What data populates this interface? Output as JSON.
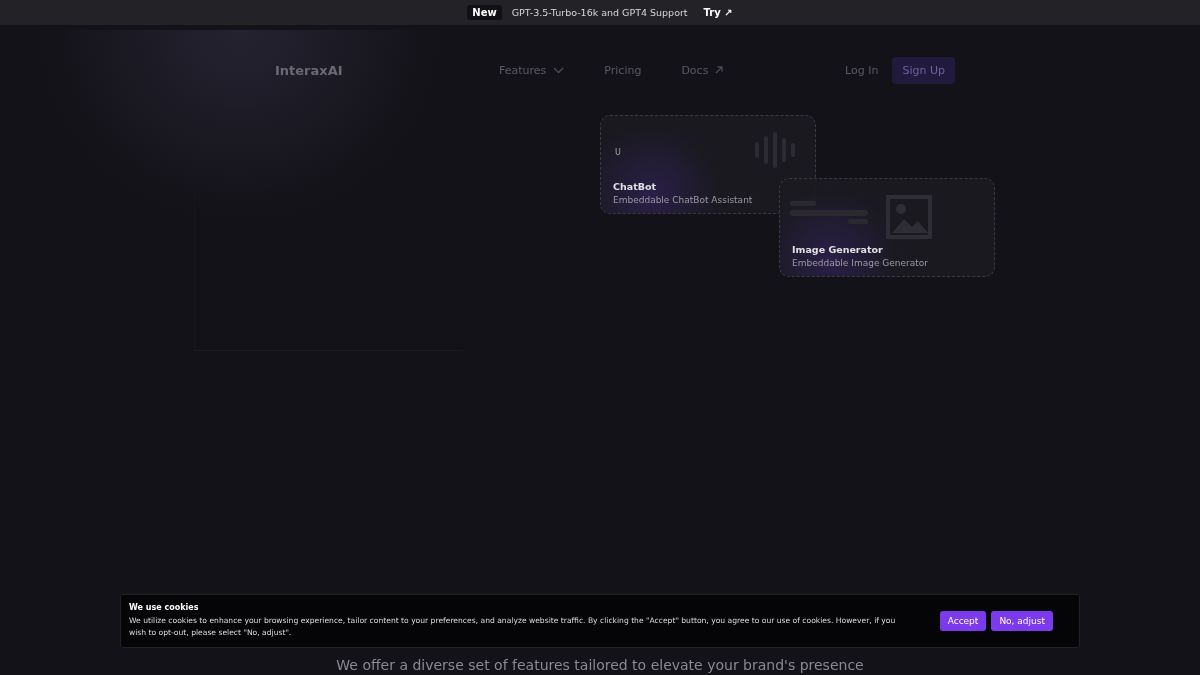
{
  "announcement": {
    "badge": "New",
    "text": "GPT-3.5-Turbo-16k and GPT4 Support",
    "link": "Try ↗"
  },
  "nav": {
    "logo": "InteraxAI",
    "links": [
      {
        "label": "Features",
        "kind": "dropdown"
      },
      {
        "label": "Pricing",
        "kind": "plain"
      },
      {
        "label": "Docs",
        "kind": "external"
      }
    ],
    "login": "Log In",
    "signup": "Sign Up"
  },
  "cards": [
    {
      "kind": "chatbot",
      "avatar_letter": "U",
      "title": "ChatBot",
      "subtitle": "Embeddable ChatBot Assistant"
    },
    {
      "kind": "image",
      "title": "Image Generator",
      "subtitle": "Embeddable Image Generator"
    }
  ],
  "subtitle": "We offer a diverse set of features tailored to elevate your brand's presence",
  "cookie": {
    "title": "We use cookies",
    "text": "We utilize cookies to enhance your browsing experience, tailor content to your preferences, and analyze website traffic. By clicking the \"Accept\" button, you agree to our use of cookies. However, if you wish to opt-out, please select \"No, adjust\".",
    "buttons": [
      "Accept",
      "No, adjust"
    ]
  }
}
